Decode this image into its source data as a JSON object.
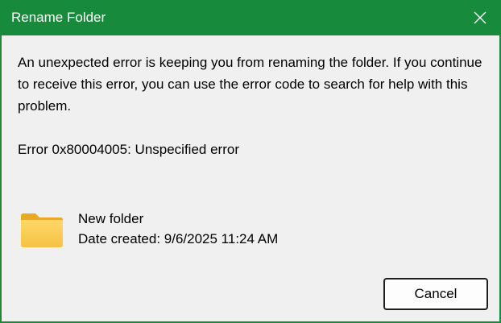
{
  "window": {
    "title": "Rename Folder",
    "close_icon": "close-icon",
    "accent": "#178a3b"
  },
  "message": {
    "text": "An unexpected error is keeping you from renaming the folder. If you continue to receive this error, you can use the error code to search for help with this problem.",
    "error": "Error 0x80004005: Unspecified error"
  },
  "file": {
    "icon": "folder-icon",
    "name": "New folder",
    "date_created": "Date created: 9/6/2025 11:24 AM"
  },
  "buttons": {
    "cancel_label": "Cancel"
  }
}
